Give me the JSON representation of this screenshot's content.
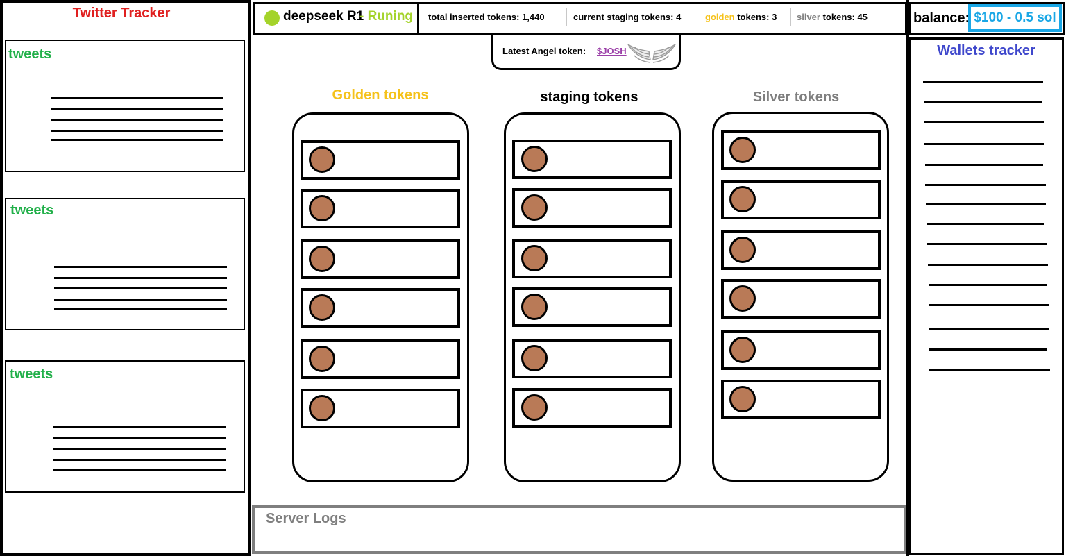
{
  "twitter": {
    "title": "Twitter Tracker",
    "cards": [
      {
        "label": "tweets"
      },
      {
        "label": "tweets"
      },
      {
        "label": "tweets"
      }
    ]
  },
  "header": {
    "model_name": "deepseek R1",
    "model_status": "- Runing",
    "stats": {
      "total_label": "total inserted tokens: 1,440",
      "staging_label": "current staging tokens: 4",
      "golden_word": "golden",
      "golden_rest": " tokens: 3",
      "silver_word": "silver",
      "silver_rest": " tokens: 45"
    }
  },
  "balance": {
    "label": "balance:",
    "value": "$100 - 0.5 sol"
  },
  "angel": {
    "label": "Latest Angel token:",
    "token": "$JOSH"
  },
  "columns": {
    "golden": {
      "title": "Golden tokens",
      "color": "#f5c21b"
    },
    "staging": {
      "title": "staging tokens",
      "color": "#000000"
    },
    "silver": {
      "title": "Silver tokens",
      "color": "#7f7f7f"
    }
  },
  "logs": {
    "title": "Server Logs"
  },
  "wallets": {
    "title": "Wallets tracker"
  },
  "colors": {
    "twitter_red": "#e02020",
    "tweet_green": "#22b04a",
    "status_green": "#a4d32a",
    "balance_blue": "#1aa7e6",
    "angel_purple": "#9b3fa8",
    "wallets_blue": "#3f48cc",
    "coin_brown": "#b97a57"
  }
}
